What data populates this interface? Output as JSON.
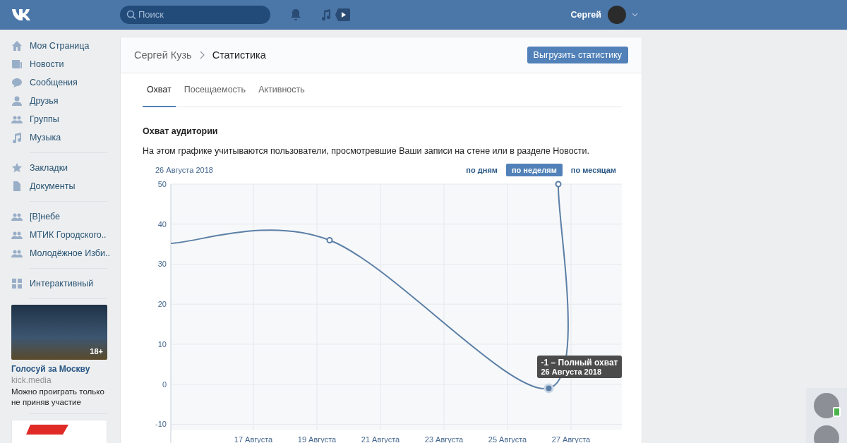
{
  "header": {
    "search": {
      "placeholder": "Поиск"
    },
    "user": {
      "name": "Сергей"
    }
  },
  "sidebar": {
    "groups": [
      [
        {
          "label": "Моя Страница"
        },
        {
          "label": "Новости"
        },
        {
          "label": "Сообщения"
        },
        {
          "label": "Друзья"
        },
        {
          "label": "Группы"
        },
        {
          "label": "Музыка"
        }
      ],
      [
        {
          "label": "Закладки"
        },
        {
          "label": "Документы"
        }
      ],
      [
        {
          "label": "[В]небе"
        },
        {
          "label": "МТИК Городского.."
        },
        {
          "label": "Молодёжное Изби.."
        }
      ],
      [
        {
          "label": "Интерактивный"
        }
      ]
    ],
    "ad": {
      "badge": "18+",
      "title": "Голосуй за Москву",
      "domain": "kick.media",
      "text": "Можно проиграть только не приняв участие"
    }
  },
  "page": {
    "breadcrumb": [
      "Сергей Кузь",
      "Статистика"
    ],
    "export_button": "Выгрузить статистику",
    "tabs": [
      {
        "label": "Охват",
        "selected": true
      },
      {
        "label": "Посещаемость",
        "selected": false
      },
      {
        "label": "Активность",
        "selected": false
      }
    ],
    "section_title": "Охват аудитории",
    "description": "На этом графике учитываются пользователи, просмотревшие Ваши записи на стене или в разделе Новости.",
    "date_label": "26 Августа 2018",
    "periods": [
      {
        "label": "по дням",
        "selected": false
      },
      {
        "label": "по неделям",
        "selected": true
      },
      {
        "label": "по месяцам",
        "selected": false
      }
    ],
    "tooltip": {
      "title": "-1 – Полный охват",
      "date": "26 Августа 2018"
    },
    "chart_data": {
      "type": "line",
      "grid": true,
      "xlim": [
        14.4,
        28.6
      ],
      "ylim": [
        -11.5,
        50
      ],
      "yticks": [
        50,
        40,
        30,
        20,
        10,
        0,
        -10
      ],
      "xticks": [
        {
          "value": 17,
          "label": "17 Августа"
        },
        {
          "value": 19,
          "label": "19 Августа"
        },
        {
          "value": 21,
          "label": "21 Августа"
        },
        {
          "value": 23,
          "label": "23 Августа"
        },
        {
          "value": 25,
          "label": "25 Августа"
        },
        {
          "value": 27,
          "label": "27 Августа"
        }
      ],
      "x": [
        14.4,
        19.4,
        26.3,
        26.6
      ],
      "series": [
        {
          "color": "#5b7fa6",
          "values": [
            35.2,
            36,
            -1,
            50
          ]
        }
      ]
    }
  },
  "chat": {
    "contacts": [
      {
        "online": true
      },
      {
        "online": false
      }
    ]
  }
}
